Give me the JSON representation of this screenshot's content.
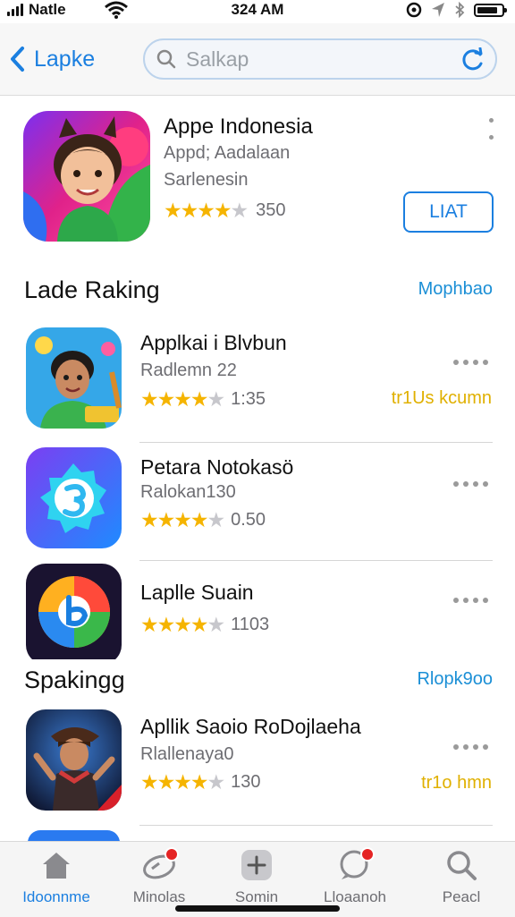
{
  "status_bar": {
    "carrier": "Natle",
    "time": "324 AM"
  },
  "nav": {
    "back_label": "Lapke",
    "search_placeholder": "Salkap"
  },
  "featured": {
    "title": "Appe Indonesia",
    "subtitle1": "Appd; Aadalaan",
    "subtitle2": "Sarlenesin",
    "rating_count": "350",
    "stars": 4,
    "button_label": "LIAT"
  },
  "sections": [
    {
      "title": "Lade Raking",
      "link": "Mophbao"
    },
    {
      "title": "Spakingg",
      "link": "Rlopk9oo"
    }
  ],
  "apps": [
    {
      "name": "Applkai i Blvbun",
      "sub": "Radlemn 22",
      "rating": "1:35",
      "stars": 4,
      "price": "tr1Us kcumn"
    },
    {
      "name": "Petara Notokasö",
      "sub": "Ralokan130",
      "rating": "0.50",
      "stars": 4,
      "price": ""
    },
    {
      "name": "Laplle Suain",
      "sub": "",
      "rating": "1103",
      "stars": 4,
      "price": ""
    },
    {
      "name": "Apllik Saoio RoDojlaeha",
      "sub": "Rlallenaya0",
      "rating": "130",
      "stars": 4,
      "price": "tr1o hmn"
    }
  ],
  "tabs": [
    {
      "label": "Idoonnme",
      "icon": "home-icon",
      "active": true
    },
    {
      "label": "Minolas",
      "icon": "games-icon",
      "active": false
    },
    {
      "label": "Somin",
      "icon": "add-icon",
      "active": false
    },
    {
      "label": "Lloaanoh",
      "icon": "updates-icon",
      "active": false
    },
    {
      "label": "Peacl",
      "icon": "search-icon",
      "active": false
    }
  ],
  "colors": {
    "accent": "#1b7fe0",
    "star": "#f5b400",
    "badge": "#e52424",
    "price": "#e0b000"
  }
}
